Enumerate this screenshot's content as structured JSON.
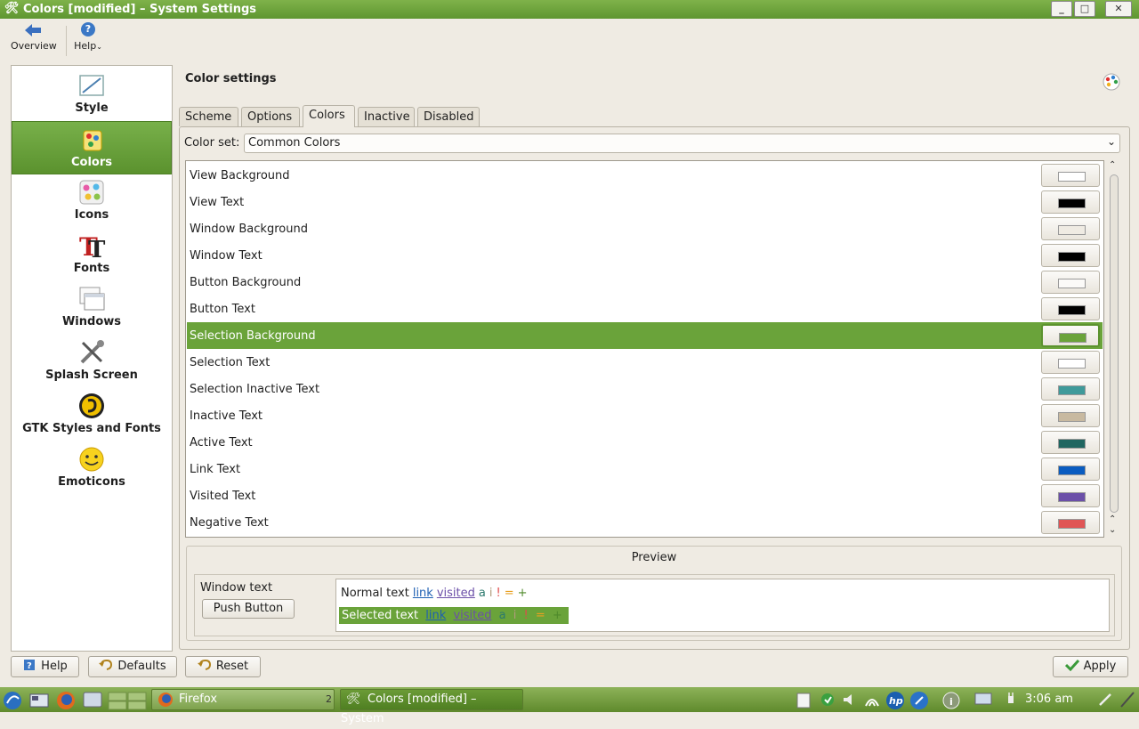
{
  "window": {
    "title": "Colors [modified] – System Settings",
    "min": "_",
    "max": "□",
    "close": "✕"
  },
  "toolbar": {
    "overview": "Overview",
    "help": "Help"
  },
  "sidebar": {
    "items": [
      {
        "label": "Style"
      },
      {
        "label": "Colors"
      },
      {
        "label": "Icons"
      },
      {
        "label": "Fonts"
      },
      {
        "label": "Windows"
      },
      {
        "label": "Splash Screen"
      },
      {
        "label": "GTK Styles and Fonts"
      },
      {
        "label": "Emoticons"
      }
    ],
    "active_index": 1
  },
  "main": {
    "title": "Color settings",
    "tabs": [
      {
        "label": "Scheme"
      },
      {
        "label": "Options"
      },
      {
        "label": "Colors"
      },
      {
        "label": "Inactive"
      },
      {
        "label": "Disabled"
      }
    ],
    "active_tab": 2,
    "color_set_label": "Color set:",
    "color_set_value": "Common Colors",
    "rows": [
      {
        "label": "View Background",
        "color": "#ffffff"
      },
      {
        "label": "View Text",
        "color": "#000000"
      },
      {
        "label": "Window Background",
        "color": "#efebe3"
      },
      {
        "label": "Window Text",
        "color": "#000000"
      },
      {
        "label": "Button Background",
        "color": "#fbfaf8"
      },
      {
        "label": "Button Text",
        "color": "#000000"
      },
      {
        "label": "Selection Background",
        "color": "#6aa33a",
        "selected": true
      },
      {
        "label": "Selection Text",
        "color": "#ffffff"
      },
      {
        "label": "Selection Inactive Text",
        "color": "#3f9a9a"
      },
      {
        "label": "Inactive Text",
        "color": "#c8b9a0"
      },
      {
        "label": "Active Text",
        "color": "#1f6660"
      },
      {
        "label": "Link Text",
        "color": "#0a5cc0"
      },
      {
        "label": "Visited Text",
        "color": "#6b4fa8"
      },
      {
        "label": "Negative Text",
        "color": "#e05555"
      }
    ]
  },
  "preview": {
    "title": "Preview",
    "window_text": "Window text",
    "push_button": "Push Button",
    "normal": {
      "normal": "Normal text",
      "link": "link",
      "visited": "visited",
      "a": "a",
      "i": "i",
      "neg": "!",
      "neu": "=",
      "pos": "+"
    },
    "selected": {
      "normal": "Selected text",
      "link": "link",
      "visited": "visited",
      "a": "a",
      "i": "i",
      "neg": "!",
      "neu": "=",
      "pos": "+"
    }
  },
  "buttons": {
    "help": "Help",
    "defaults": "Defaults",
    "reset": "Reset",
    "apply": "Apply"
  },
  "taskbar": {
    "firefox_task": "Firefox",
    "firefox_count": "2",
    "settings_task": "Colors [modified] – System",
    "clock": "3:06 am"
  }
}
